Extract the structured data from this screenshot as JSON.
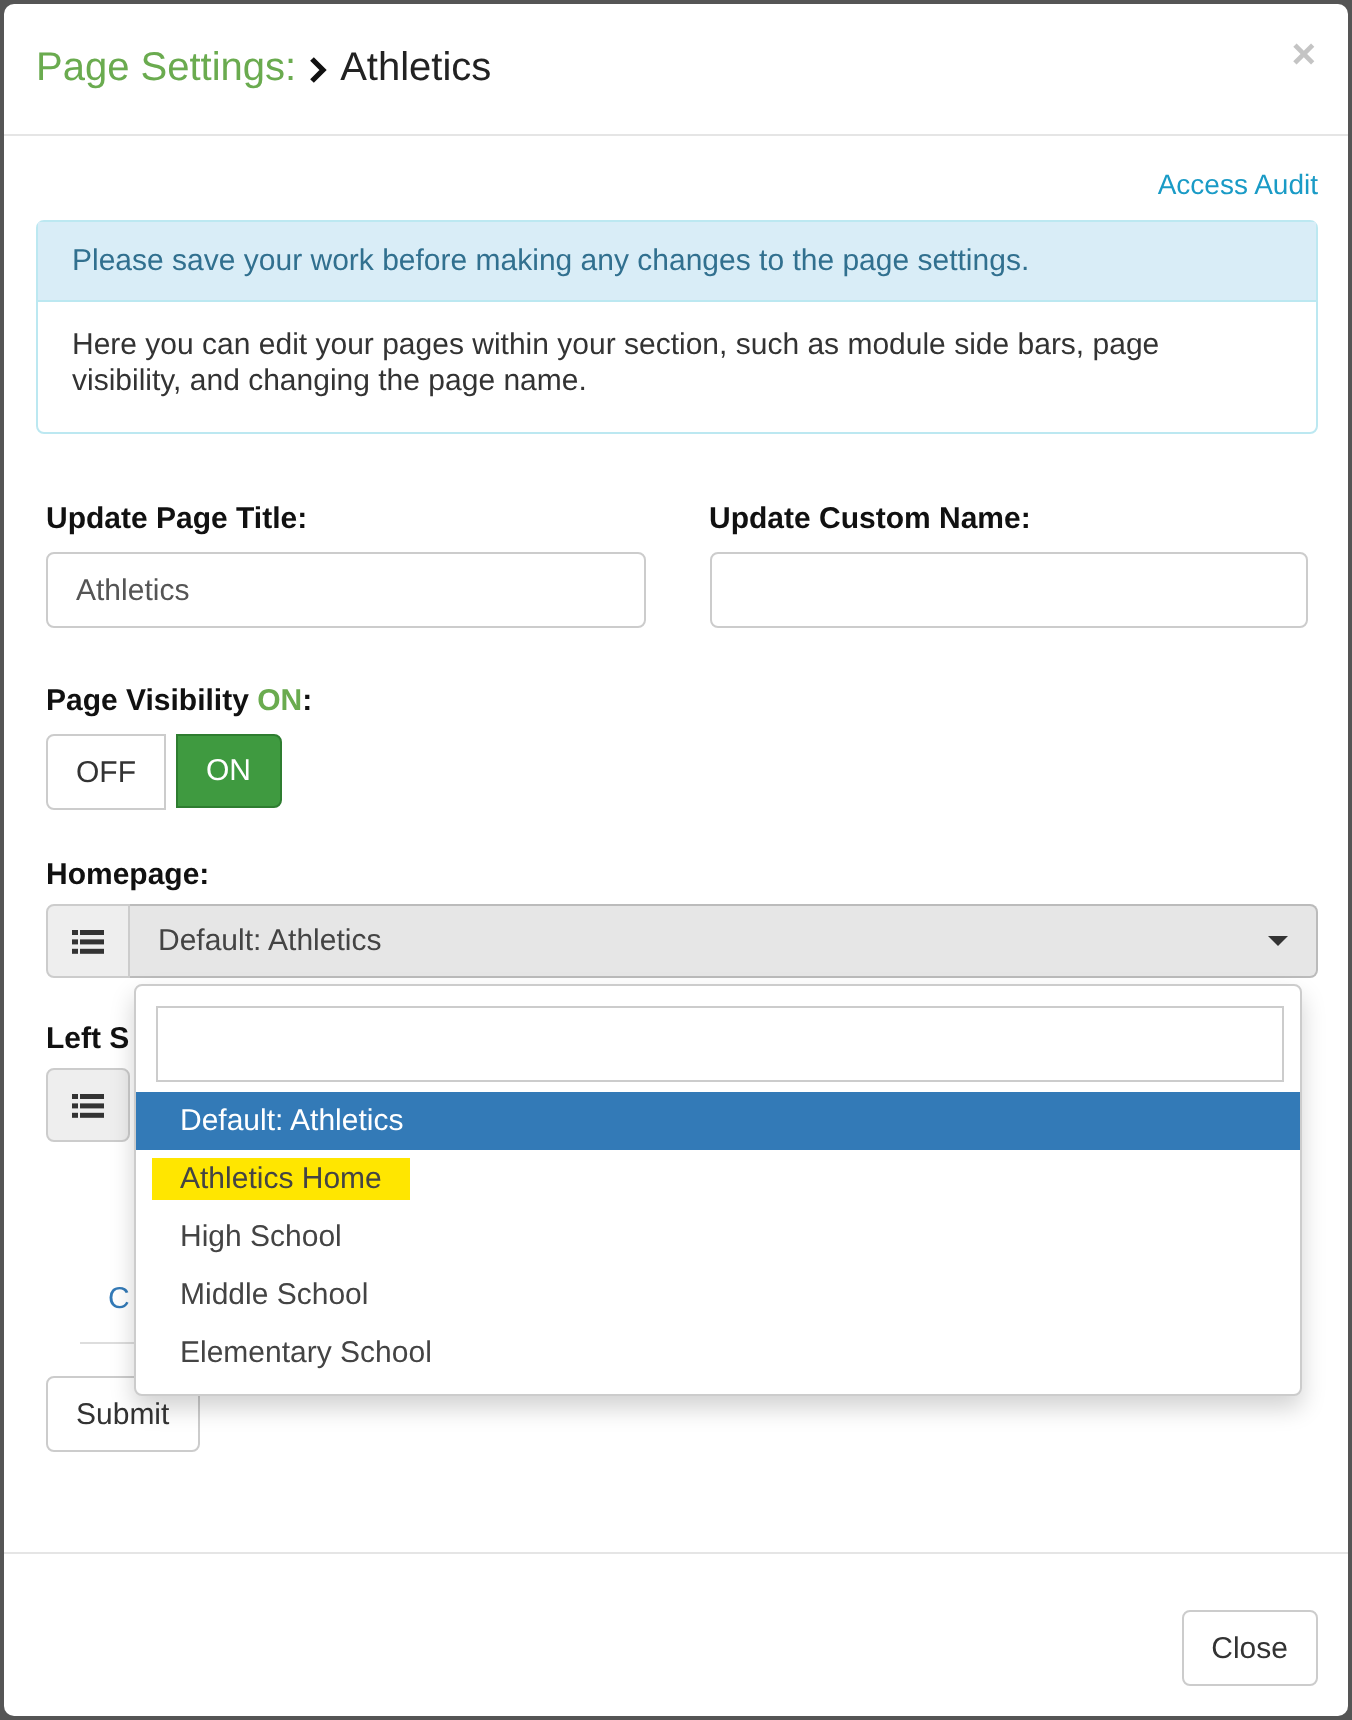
{
  "modal": {
    "title": "Page Settings:",
    "breadcrumb": "Athletics",
    "close_symbol": "×"
  },
  "access_audit": "Access Audit",
  "alert": {
    "heading": "Please save your work before making any changes to the page settings.",
    "body": "Here you can edit your pages within your section, such as module side bars, page visibility, and changing the page name."
  },
  "fields": [
    {
      "label": "Update Page Title:",
      "value": "Athletics"
    },
    {
      "label": "Update Custom Name:"
    }
  ],
  "visibility": {
    "label": "Page Visibility",
    "status": "ON",
    "suffix": ":",
    "options": [
      {
        "label": "OFF",
        "selected": false
      },
      {
        "label": "ON",
        "selected": true
      }
    ]
  },
  "homepage": {
    "label": "Homepage:",
    "value": "Default: Athletics",
    "expanded": true,
    "options": [
      {
        "label": "Default: Athletics",
        "selected": true,
        "highlighted": false
      },
      {
        "label": "Athletics Home",
        "selected": false,
        "highlighted": true
      },
      {
        "label": "High School",
        "selected": false,
        "highlighted": false
      },
      {
        "label": "Middle School",
        "selected": false,
        "highlighted": false
      },
      {
        "label": "Elementary School",
        "selected": false,
        "highlighted": false
      }
    ]
  },
  "left_sidebar": {
    "label": "Left S"
  },
  "partial_link": "C",
  "buttons": {
    "submit": "Submit",
    "close": "Close"
  }
}
